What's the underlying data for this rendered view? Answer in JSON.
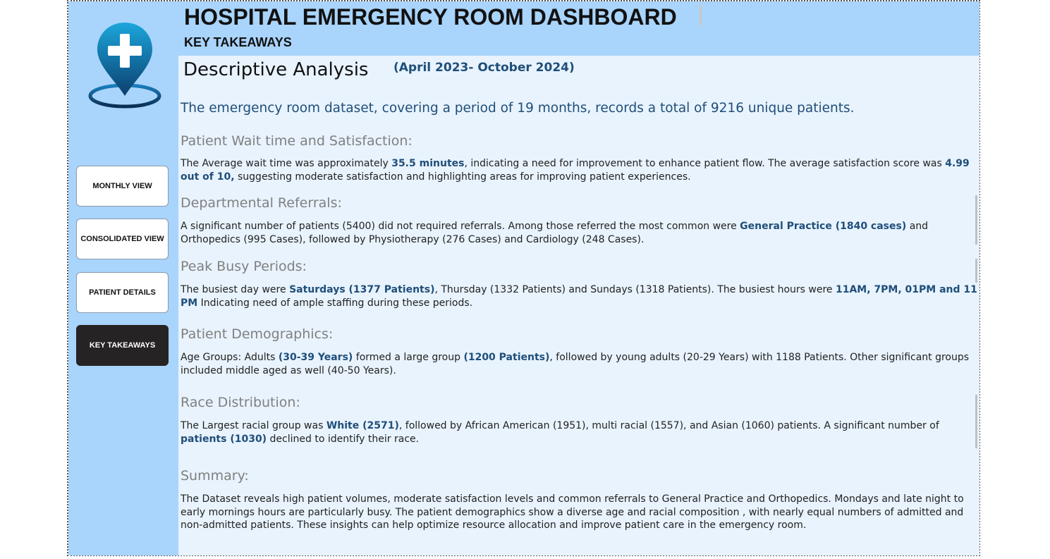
{
  "header": {
    "title": "HOSPITAL EMERGENCY ROOM DASHBOARD",
    "subtitle": "KEY TAKEAWAYS"
  },
  "logo": {
    "icon": "hospital-location-pin-icon",
    "color_top": "#1aa0d8",
    "color_bottom": "#0b3f6e"
  },
  "nav": {
    "items": [
      {
        "label": "MONTHLY VIEW",
        "active": false
      },
      {
        "label": "CONSOLIDATED VIEW",
        "active": false
      },
      {
        "label": "PATIENT DETAILS",
        "active": false
      },
      {
        "label": "KEY TAKEAWAYS",
        "active": true
      }
    ]
  },
  "analysis": {
    "title": "Descriptive Analysis",
    "period": "(April 2023- October 2024)",
    "lead": "The emergency room dataset, covering a period of 19 months, records a total of 9216 unique patients."
  },
  "sections": [
    {
      "heading": "Patient Wait time and Satisfaction:",
      "parts": [
        {
          "t": "The Average wait time was approximately ",
          "hl": false
        },
        {
          "t": "35.5 minutes",
          "hl": true
        },
        {
          "t": ", indicating a need for improvement to enhance patient flow. The average satisfaction score was ",
          "hl": false
        },
        {
          "t": "4.99 out of 10,",
          "hl": true
        },
        {
          "t": " suggesting moderate satisfaction and highlighting areas for improving patient experiences.",
          "hl": false
        }
      ]
    },
    {
      "heading": "Departmental Referrals:",
      "parts": [
        {
          "t": "A significant number of patients (5400) did not required referrals. Among those referred the most common were ",
          "hl": false
        },
        {
          "t": "General Practice (1840 cases)",
          "hl": true
        },
        {
          "t": " and Orthopedics (995 Cases), followed by Physiotherapy (276 Cases)  and Cardiology (248 Cases).",
          "hl": false
        }
      ]
    },
    {
      "heading": "Peak Busy Periods:",
      "parts": [
        {
          "t": "The busiest day were ",
          "hl": false
        },
        {
          "t": "Saturdays (1377 Patients)",
          "hl": true
        },
        {
          "t": ", Thursday (1332 Patients) and Sundays (1318 Patients). The busiest hours were ",
          "hl": false
        },
        {
          "t": "11AM, 7PM, 01PM and 11 PM",
          "hl": true
        },
        {
          "t": " Indicating need of ample staffing during these periods.",
          "hl": false
        }
      ]
    },
    {
      "heading": "Patient Demographics:",
      "parts": [
        {
          "t": "Age Groups: Adults ",
          "hl": false
        },
        {
          "t": "(30-39 Years)",
          "hl": true
        },
        {
          "t": " formed a large group ",
          "hl": false
        },
        {
          "t": "(1200 Patients)",
          "hl": true
        },
        {
          "t": ", followed by young adults (20-29 Years) with 1188 Patients. Other significant groups included middle aged as well (40-50 Years).",
          "hl": false
        }
      ]
    },
    {
      "heading": "Race Distribution:",
      "parts": [
        {
          "t": "The Largest racial group was ",
          "hl": false
        },
        {
          "t": "White (2571)",
          "hl": true
        },
        {
          "t": ",  followed by African American (1951), multi racial (1557), and Asian (1060) patients. A significant number of ",
          "hl": false
        },
        {
          "t": "patients (1030)",
          "hl": true
        },
        {
          "t": " declined to identify their race.",
          "hl": false
        }
      ]
    },
    {
      "heading": "Summary:",
      "parts": [
        {
          "t": "The Dataset reveals high patient volumes, moderate satisfaction levels and common referrals to General Practice and Orthopedics. Mondays and late night to early mornings hours are particularly busy. The patient demographics show a diverse age and racial composition , with nearly equal numbers of admitted and non-admitted patients. These insights can help optimize resource allocation and improve patient care in the emergency room.",
          "hl": false
        }
      ]
    }
  ]
}
